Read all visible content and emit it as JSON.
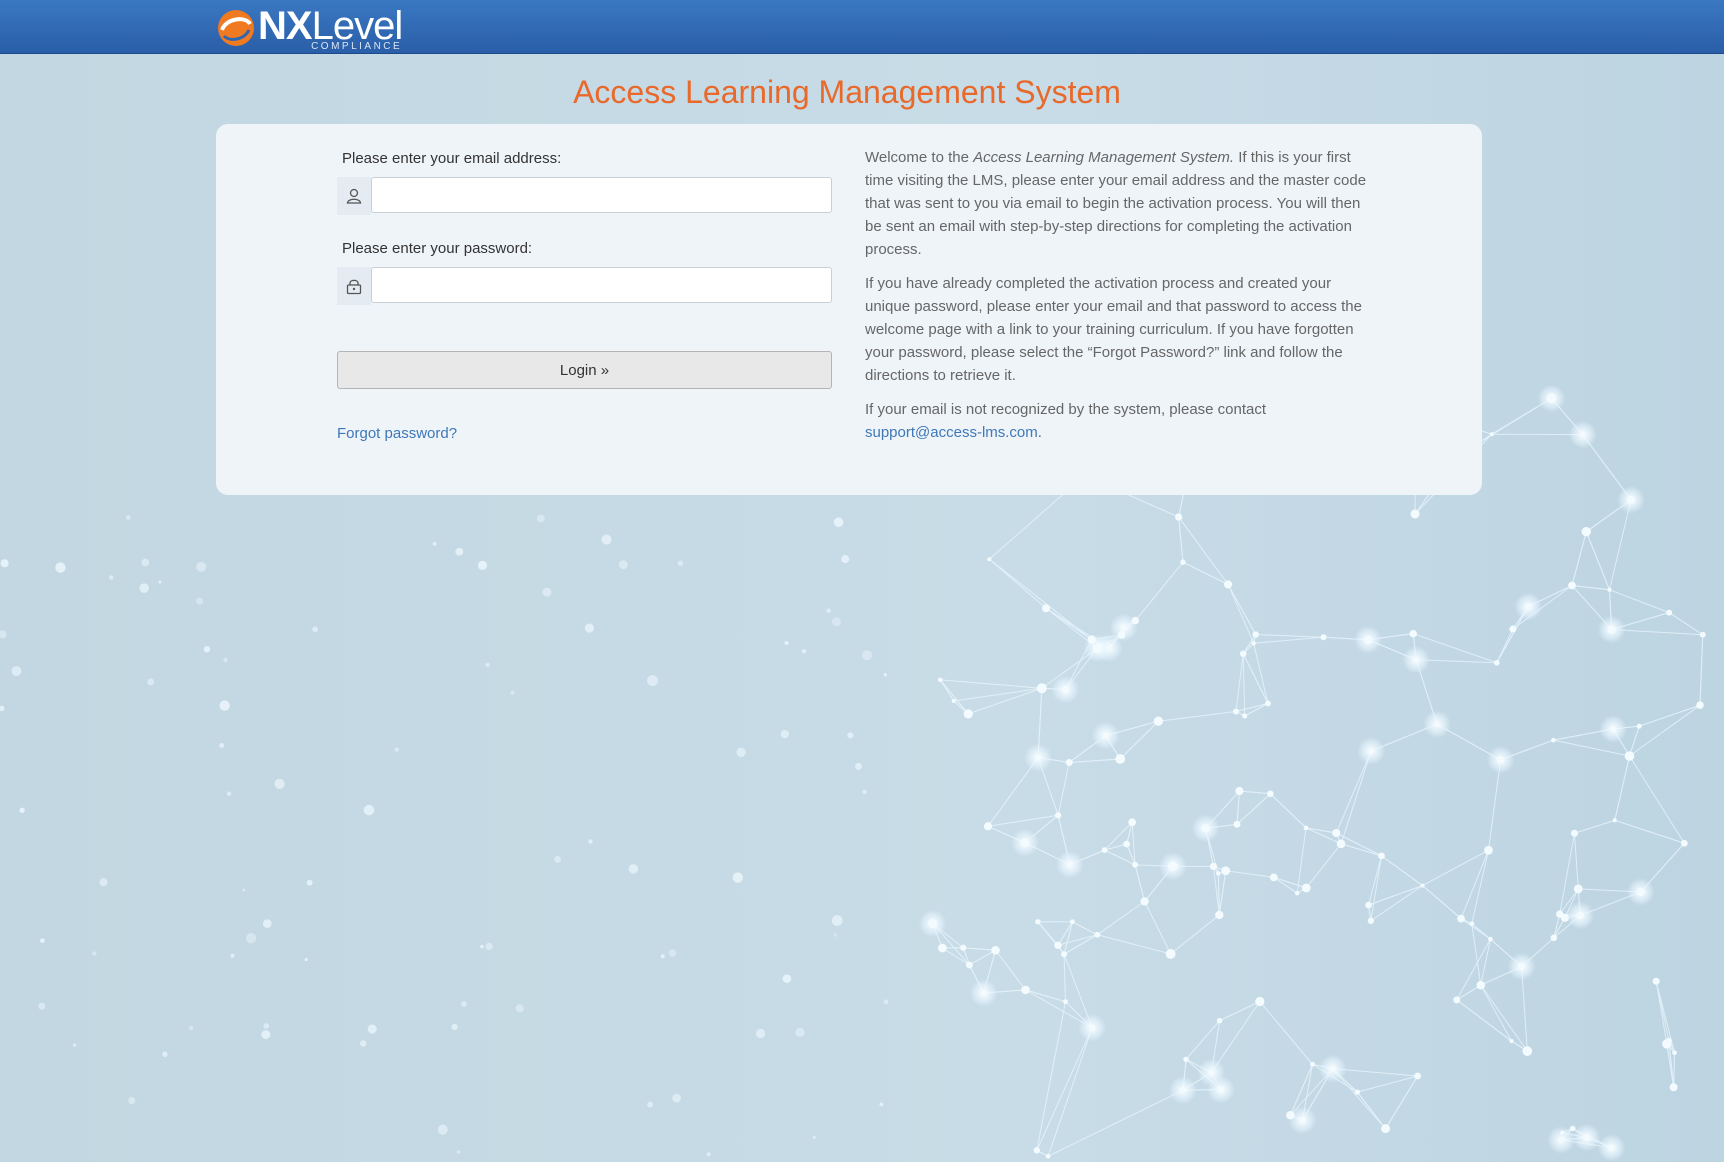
{
  "header": {
    "logo_main": "NX",
    "logo_level": "Level",
    "logo_sub": "COMPLIANCE"
  },
  "page": {
    "title": "Access Learning Management System"
  },
  "form": {
    "email_label": "Please enter your email address:",
    "email_value": "",
    "password_label": "Please enter your password:",
    "password_value": "",
    "login_label": "Login »",
    "forgot_label": "Forgot password?"
  },
  "info": {
    "p1_before": "Welcome to the ",
    "p1_italic": "Access Learning Management System.",
    "p1_after": " If this is your first time visiting the LMS, please enter your email address and the master code that was sent to you via email to begin the activation process. You will then be sent an email with step-by-step directions for completing the activation process.",
    "p2": "If you have already completed the activation process and created your unique password, please enter your email and that password to access the welcome page with a link to your training curriculum. If you have forgotten your password, please select the “Forgot Password?” link and follow the directions to retrieve it.",
    "p3_before": "If your email is not recognized by the system, please contact ",
    "support_email": "support@access-lms.com",
    "p3_after": "."
  },
  "icons": {
    "user": "user-icon",
    "lock": "lock-icon",
    "logo": "nxlevel-logo-mark"
  },
  "colors": {
    "title": "#e8692a",
    "header": "#2f66b0",
    "link": "#3e78b8",
    "logo_accent": "#f07a22"
  }
}
